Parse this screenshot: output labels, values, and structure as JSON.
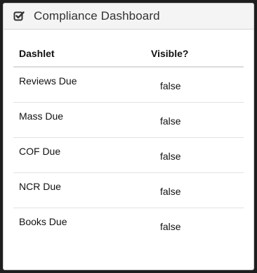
{
  "panel": {
    "title": "Compliance Dashboard",
    "icon": "checkbox-checked-icon"
  },
  "table": {
    "headers": [
      "Dashlet",
      "Visible?"
    ],
    "rows": [
      {
        "dashlet": "Reviews Due",
        "visible": "false"
      },
      {
        "dashlet": "Mass Due",
        "visible": "false"
      },
      {
        "dashlet": "COF Due",
        "visible": "false"
      },
      {
        "dashlet": "NCR Due",
        "visible": "false"
      },
      {
        "dashlet": "Books Due",
        "visible": "false"
      }
    ]
  }
}
